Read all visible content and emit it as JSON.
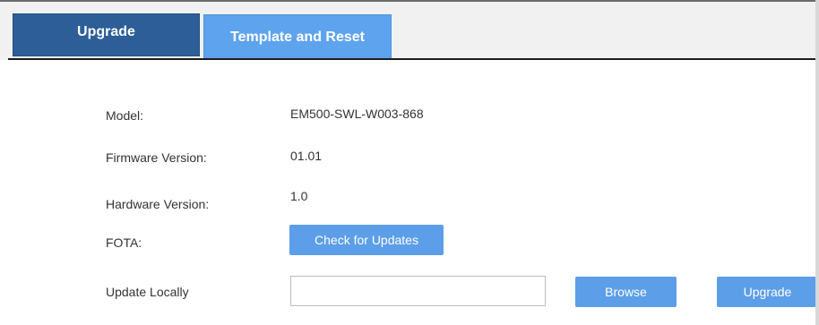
{
  "tabs": {
    "upgrade": "Upgrade",
    "template_reset": "Template and Reset"
  },
  "info": {
    "model_label": "Model:",
    "model_value": "EM500-SWL-W003-868",
    "firmware_label": "Firmware Version:",
    "firmware_value": "01.01",
    "hardware_label": "Hardware Version:",
    "hardware_value": "1.0",
    "fota_label": "FOTA:",
    "check_updates_label": "Check for Updates",
    "update_locally_label": "Update Locally",
    "file_value": "",
    "browse_label": "Browse",
    "upgrade_label": "Upgrade"
  },
  "colors": {
    "active_tab": "#2d5e98",
    "inactive_tab": "#5ea3ee",
    "button": "#5c9ee8"
  }
}
